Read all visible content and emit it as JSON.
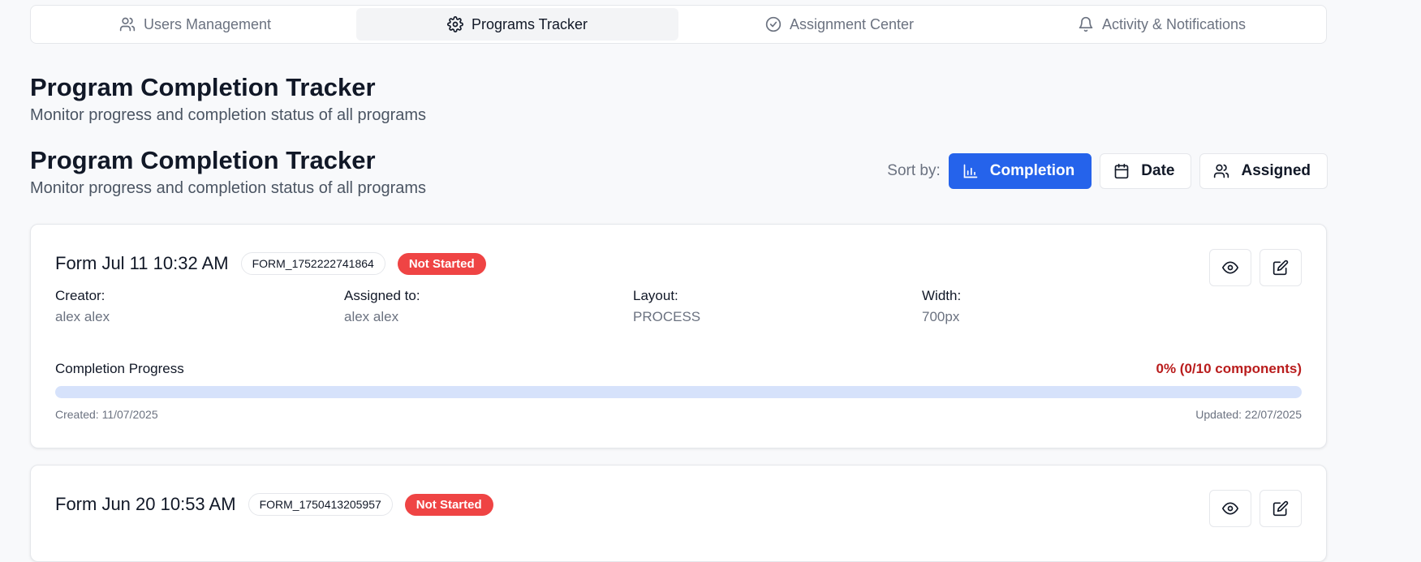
{
  "tabs": [
    {
      "label": "Users Management",
      "icon": "users-icon",
      "active": false
    },
    {
      "label": "Programs Tracker",
      "icon": "gear-icon",
      "active": true
    },
    {
      "label": "Assignment Center",
      "icon": "check-circle-icon",
      "active": false
    },
    {
      "label": "Activity & Notifications",
      "icon": "bell-icon",
      "active": false
    }
  ],
  "header": {
    "title": "Program Completion Tracker",
    "subtitle": "Monitor progress and completion status of all programs"
  },
  "section": {
    "title": "Program Completion Tracker",
    "subtitle": "Monitor progress and completion status of all programs"
  },
  "sort": {
    "label": "Sort by:",
    "options": [
      {
        "label": "Completion",
        "icon": "bar-chart-icon",
        "active": true
      },
      {
        "label": "Date",
        "icon": "calendar-icon",
        "active": false
      },
      {
        "label": "Assigned",
        "icon": "users-icon",
        "active": false
      }
    ]
  },
  "colors": {
    "accent": "#2563eb",
    "status_not_started": "#ef4444",
    "progress_text": "#b91c1c",
    "progress_track": "#d6e2fb"
  },
  "programs": [
    {
      "title": "Form Jul 11 10:32 AM",
      "code": "FORM_1752222741864",
      "status": "Not Started",
      "fields": [
        {
          "label": "Creator:",
          "value": "alex alex"
        },
        {
          "label": "Assigned to:",
          "value": "alex alex"
        },
        {
          "label": "Layout:",
          "value": "PROCESS"
        },
        {
          "label": "Width:",
          "value": "700px"
        }
      ],
      "progress_label": "Completion Progress",
      "progress_text": "0% (0/10 components)",
      "progress_fraction": 0,
      "created": "Created: 11/07/2025",
      "updated": "Updated: 22/07/2025"
    },
    {
      "title": "Form Jun 20 10:53 AM",
      "code": "FORM_1750413205957",
      "status": "Not Started"
    }
  ]
}
